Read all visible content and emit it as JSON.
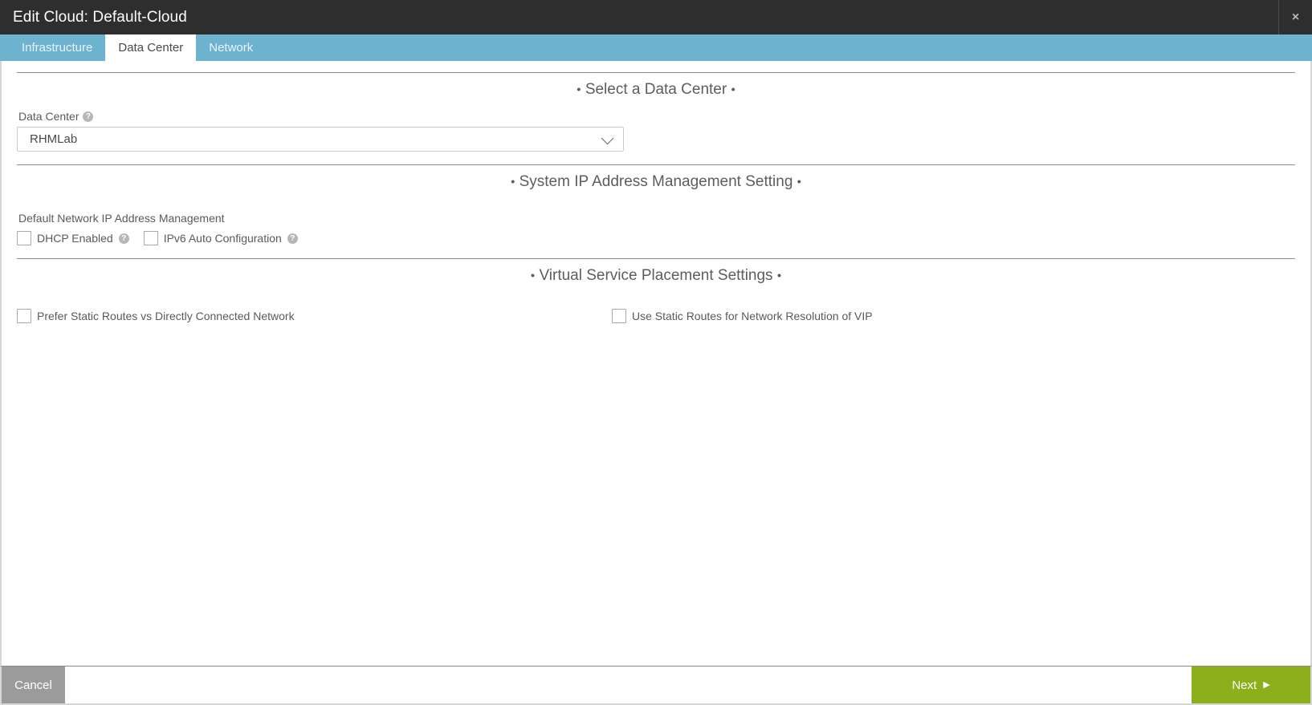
{
  "titlebar": {
    "title": "Edit Cloud: Default-Cloud",
    "close_label": "×"
  },
  "tabs": [
    {
      "label": "Infrastructure",
      "active": false
    },
    {
      "label": "Data Center",
      "active": true
    },
    {
      "label": "Network",
      "active": false
    }
  ],
  "sections": {
    "data_center": {
      "heading": "Select a Data Center",
      "bullet": "•",
      "field_label": "Data Center",
      "help_glyph": "?",
      "selected_value": "RHMLab"
    },
    "ip_management": {
      "heading": "System IP Address Management Setting",
      "bullet": "•",
      "sub_label": "Default Network IP Address Management",
      "checkboxes": [
        {
          "label": "DHCP Enabled",
          "checked": false,
          "has_help": true
        },
        {
          "label": "IPv6 Auto Configuration",
          "checked": false,
          "has_help": true
        }
      ]
    },
    "virtual_service": {
      "heading": "Virtual Service Placement Settings",
      "bullet": "•",
      "checkboxes": [
        {
          "label": "Prefer Static Routes vs Directly Connected Network",
          "checked": false,
          "has_help": false
        },
        {
          "label": "Use Static Routes for Network Resolution of VIP",
          "checked": false,
          "has_help": false
        }
      ]
    }
  },
  "footer": {
    "cancel_label": "Cancel",
    "next_label": "Next",
    "next_arrow": "▶"
  },
  "colors": {
    "titlebar_bg": "#2e2e2e",
    "tabbar_bg": "#6db2cf",
    "cancel_bg": "#9b9b9b",
    "next_bg": "#8cb01b"
  }
}
